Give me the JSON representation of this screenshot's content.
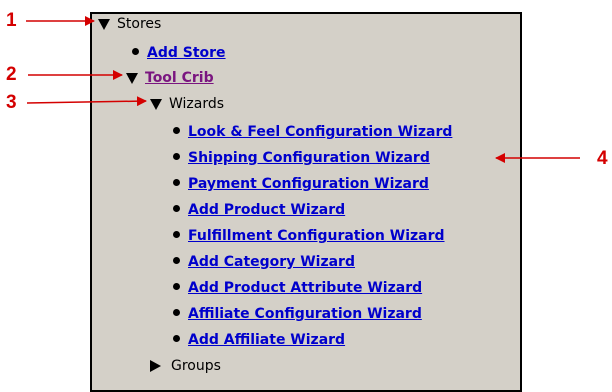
{
  "tree": {
    "stores": {
      "label": "Stores",
      "icon": "expanded-triangle-icon"
    },
    "add_store": {
      "label": "Add Store"
    },
    "tool_crib": {
      "label": "Tool Crib",
      "icon": "expanded-triangle-icon"
    },
    "wizards": {
      "label": "Wizards",
      "icon": "expanded-triangle-icon",
      "items": [
        {
          "label": "Look & Feel Configuration Wizard"
        },
        {
          "label": "Shipping Configuration Wizard"
        },
        {
          "label": "Payment Configuration Wizard"
        },
        {
          "label": "Add Product Wizard"
        },
        {
          "label": "Fulfillment Configuration Wizard"
        },
        {
          "label": "Add Category Wizard"
        },
        {
          "label": "Add Product Attribute Wizard"
        },
        {
          "label": "Affiliate Configuration Wizard"
        },
        {
          "label": "Add Affiliate Wizard"
        }
      ]
    },
    "groups": {
      "label": "Groups",
      "icon": "collapsed-triangle-icon"
    }
  },
  "callouts": [
    "1",
    "2",
    "3",
    "4"
  ],
  "colors": {
    "link": "#0000cc",
    "visited_link": "#7a1680",
    "callout": "#d40000",
    "panel_bg": "#d4d0c8"
  }
}
